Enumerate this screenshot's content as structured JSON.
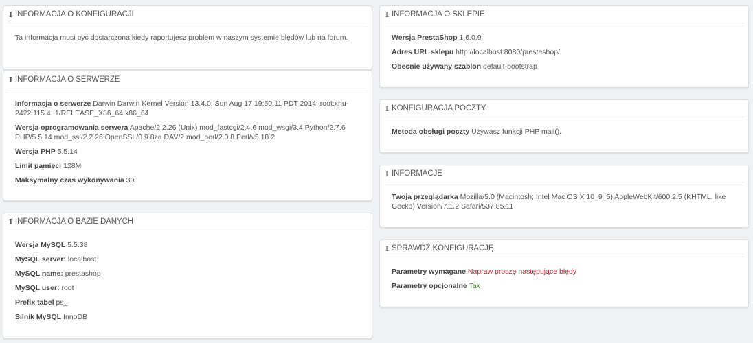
{
  "config_info": {
    "title": "INFORMACJA O KONFIGURACJI",
    "text": "Ta informacja musi być dostarczona kiedy raportujesz problem w naszym systemie błędów lub na forum."
  },
  "server_info": {
    "title": "INFORMACJA O SERWERZE",
    "rows": [
      {
        "label": "Informacja o serwerze",
        "value": "Darwin Darwin Kernel Version 13.4.0: Sun Aug 17 19:50:11 PDT 2014; root:xnu-2422.115.4~1/RELEASE_X86_64 x86_64"
      },
      {
        "label": "Wersja oprogramowania serwera",
        "value": "Apache/2.2.26 (Unix) mod_fastcgi/2.4.6 mod_wsgi/3.4 Python/2.7.6 PHP/5.5.14 mod_ssl/2.2.26 OpenSSL/0.9.8za DAV/2 mod_perl/2.0.8 Perl/v5.18.2"
      },
      {
        "label": "Wersja PHP",
        "value": "5.5.14"
      },
      {
        "label": "Limit pamięci",
        "value": "128M"
      },
      {
        "label": "Maksymalny czas wykonywania",
        "value": "30"
      }
    ]
  },
  "db_info": {
    "title": "INFORMACJA O BAZIE DANYCH",
    "rows": [
      {
        "label": "Wersja MySQL",
        "value": "5.5.38"
      },
      {
        "label": "MySQL server:",
        "value": "localhost"
      },
      {
        "label": "MySQL name:",
        "value": "prestashop"
      },
      {
        "label": "MySQL user:",
        "value": "root"
      },
      {
        "label": "Prefix tabel",
        "value": "ps_"
      },
      {
        "label": "Silnik MySQL",
        "value": "InnoDB"
      }
    ]
  },
  "shop_info": {
    "title": "INFORMACJA O SKLEPIE",
    "rows": [
      {
        "label": "Wersja PrestaShop",
        "value": "1.6.0.9"
      },
      {
        "label": "Adres URL sklepu",
        "value": "http://localhost:8080/prestashop/"
      },
      {
        "label": "Obecnie używany szablon",
        "value": "default-bootstrap"
      }
    ]
  },
  "mail_config": {
    "title": "KONFIGURACJA POCZTY",
    "rows": [
      {
        "label": "Metoda obsługi poczty",
        "value": "Używasz funkcji PHP mail()."
      }
    ]
  },
  "info": {
    "title": "INFORMACJE",
    "rows": [
      {
        "label": "Twoja przeglądarka",
        "value": "Mozilla/5.0 (Macintosh; Intel Mac OS X 10_9_5) AppleWebKit/600.2.5 (KHTML, like Gecko) Version/7.1.2 Safari/537.85.11"
      }
    ]
  },
  "check_config": {
    "title": "SPRAWDŹ KONFIGURACJĘ",
    "rows": [
      {
        "label": "Parametry wymagane",
        "value": "Napraw proszę następujące błędy",
        "status": "error"
      },
      {
        "label": "Parametry opcjonalne",
        "value": "Tak",
        "status": "ok"
      }
    ]
  },
  "icon": "info-icon",
  "colors": {
    "error": "#b02b2c",
    "ok": "#3b7a2f"
  }
}
